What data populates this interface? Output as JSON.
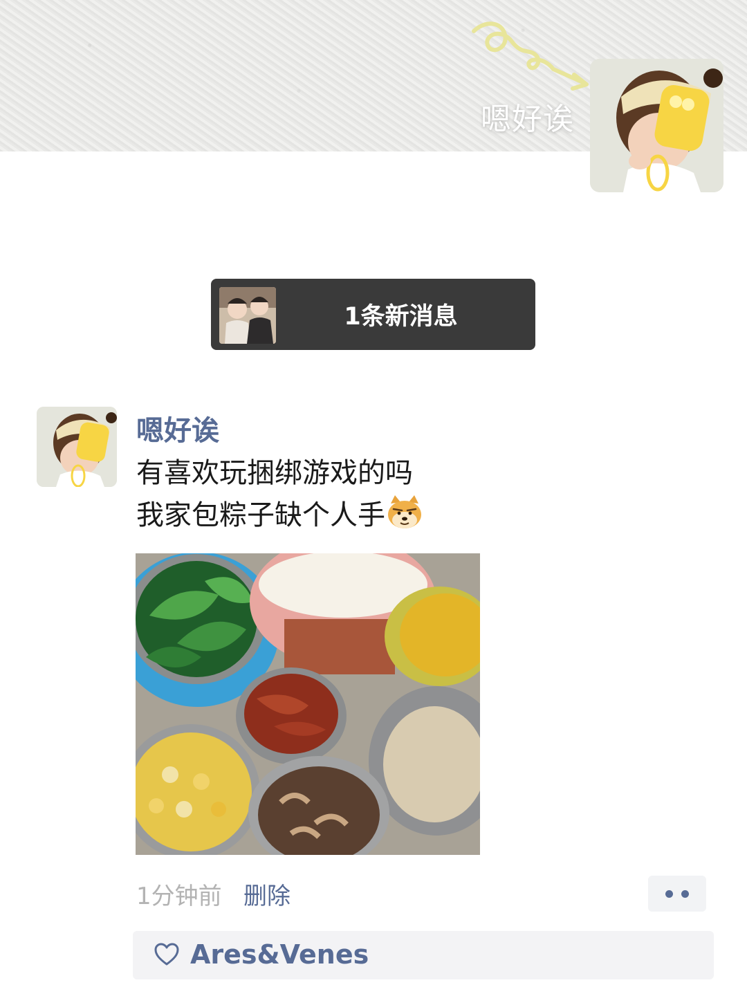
{
  "cover": {
    "username": "嗯好诶"
  },
  "notification": {
    "label": "1条新消息"
  },
  "post": {
    "author": "嗯好诶",
    "text_lines": [
      "有喜欢玩捆绑游戏的吗",
      "我家包粽子缺个人手"
    ],
    "time": "1分钟前",
    "delete_label": "删除",
    "likes": [
      "Ares&Venes"
    ]
  },
  "colors": {
    "link": "#576b95",
    "pill_bg": "#3a3a3a",
    "meta_gray": "#b3b3b3"
  },
  "icons": {
    "emoji": "doge-emoji-icon",
    "like": "heart-outline-icon",
    "more": "more-dots-icon"
  }
}
